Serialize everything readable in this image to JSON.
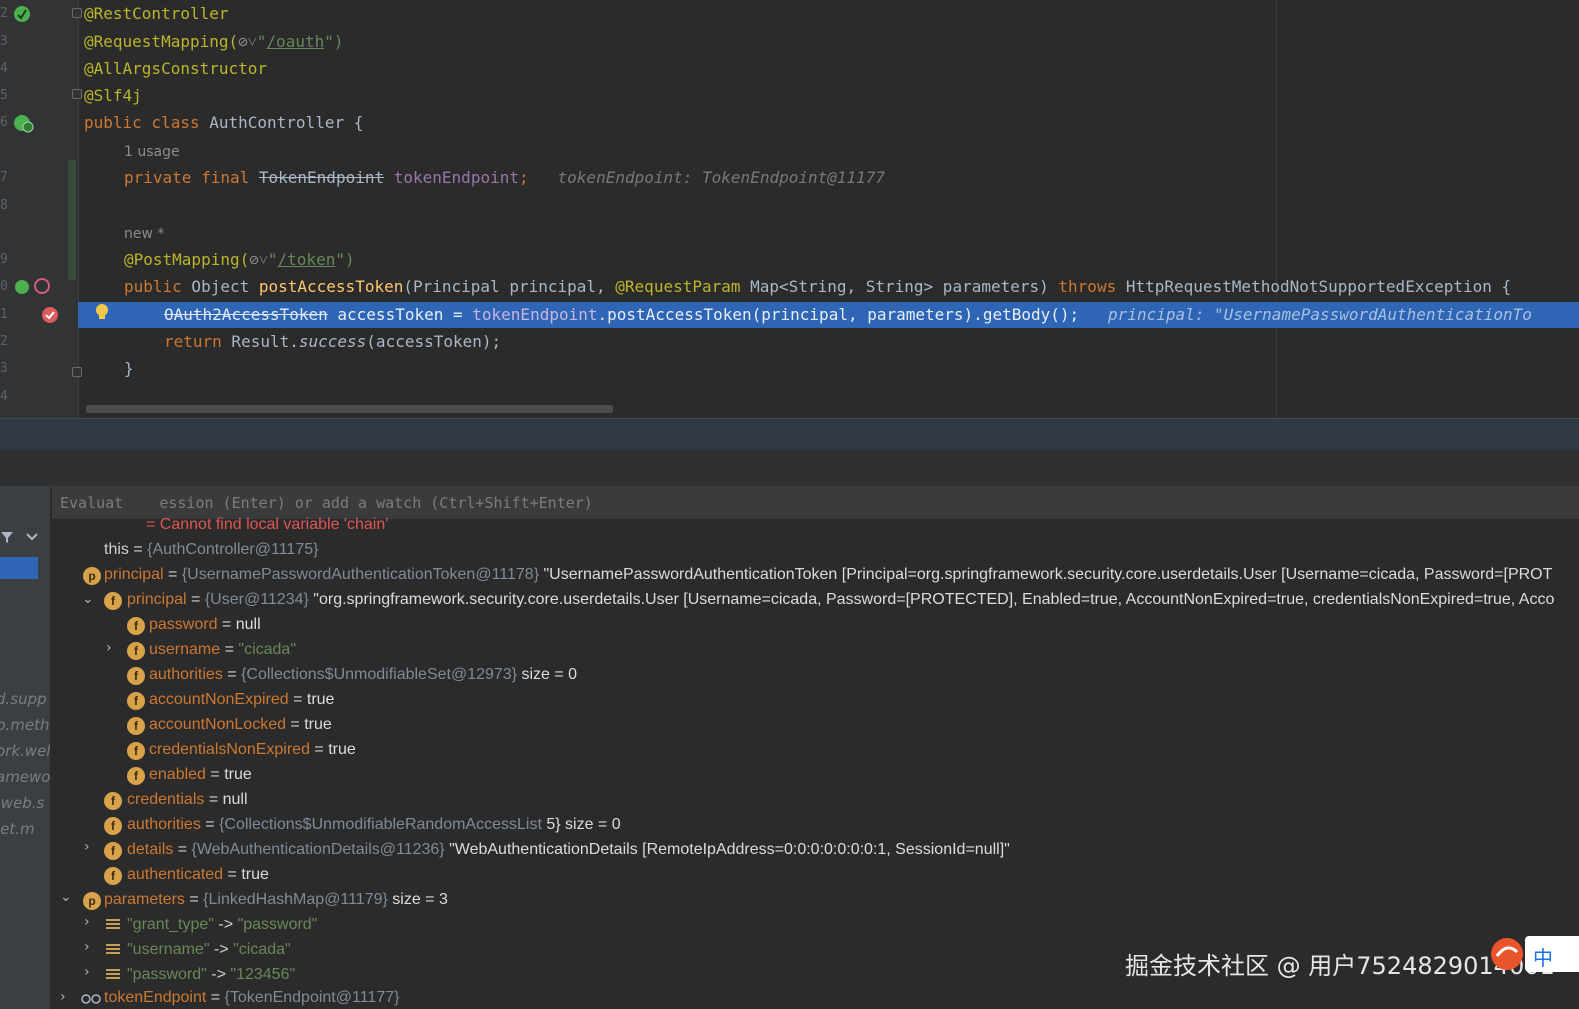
{
  "editor": {
    "line_numbers": [
      "2",
      "3",
      "4",
      "5",
      "6",
      "7",
      "8",
      "9",
      "0",
      "1",
      "2",
      "3",
      "4"
    ],
    "lines": {
      "l1": "@RestController",
      "l2_prefix": "@RequestMapping(",
      "l2_mid": "\"",
      "l2_path": "/oauth",
      "l2_suffix": "\")",
      "l3": "@AllArgsConstructor",
      "l4": "@Slf4j",
      "l5_kw": "public class",
      "l5_name": " AuthController {",
      "usage": "1 usage",
      "l6_kw": "private final",
      "l6_type": "TokenEndpoint",
      "l6_field": "tokenEndpoint",
      "l6_semi": ";",
      "l6_hint": "tokenEndpoint: TokenEndpoint@11177",
      "new_marker": "new *",
      "l7_ann": "@PostMapping(",
      "l7_quote": "\"",
      "l7_path": "/token",
      "l7_end": "\")",
      "l8_kw": "public",
      "l8_type": " Object ",
      "l8_fn": "postAccessToken",
      "l8_params1": "(Principal principal, ",
      "l8_ann": "@RequestParam",
      "l8_params2": " Map<String, String> parameters) ",
      "l8_throws": "throws",
      "l8_exc": " HttpRequestMethodNotSupportedException {",
      "l9_type": "OAuth2AccessToken",
      "l9_rest1": " accessToken = ",
      "l9_field": "tokenEndpoint",
      "l9_rest2": ".postAccessToken(principal, parameters).getBody();",
      "l9_hint": "principal: \"UsernamePasswordAuthenticationTo",
      "l10_kw": "return",
      "l10_mid": " Result.",
      "l10_fn": "success",
      "l10_end": "(accessToken);",
      "l11": "}"
    }
  },
  "debugger": {
    "eval_placeholder": "Evaluat    ession (Enter) or add a watch (Ctrl+Shift+Enter)",
    "left_panel_text": [
      "d.supp",
      "b.meth",
      "ork.wel",
      "amewo",
      ".web.s",
      "let.m"
    ],
    "vars": [
      {
        "name": "",
        "eq": " = ",
        "type": "",
        "value": "Cannot find local variable 'chain'",
        "err": true
      },
      {
        "name": "this",
        "eq": " = ",
        "type": "{AuthController@11175}",
        "value": ""
      },
      {
        "name": "principal",
        "eq": " = ",
        "type": "{UsernamePasswordAuthenticationToken@11178}",
        "value": " \"UsernamePasswordAuthenticationToken [Principal=org.springframework.security.core.userdetails.User [Username=cicada, Password=[PROT"
      },
      {
        "name": "principal",
        "eq": " = ",
        "type": "{User@11234}",
        "value": " \"org.springframework.security.core.userdetails.User [Username=cicada, Password=[PROTECTED], Enabled=true, AccountNonExpired=true, credentialsNonExpired=true, Acco"
      },
      {
        "name": "password",
        "eq": " = ",
        "type": "",
        "value": "null"
      },
      {
        "name": "username",
        "eq": " = ",
        "type": "",
        "value": "\"cicada\"",
        "str": true
      },
      {
        "name": "authorities",
        "eq": " = ",
        "type": "{Collections$UnmodifiableSet@12973}",
        "value": "  size = 0"
      },
      {
        "name": "accountNonExpired",
        "eq": " = ",
        "type": "",
        "value": "true"
      },
      {
        "name": "accountNonLocked",
        "eq": " = ",
        "type": "",
        "value": "true"
      },
      {
        "name": "credentialsNonExpired",
        "eq": " = ",
        "type": "",
        "value": "true"
      },
      {
        "name": "enabled",
        "eq": " = ",
        "type": "",
        "value": "true"
      },
      {
        "name": "credentials",
        "eq": " = ",
        "type": "",
        "value": "null"
      },
      {
        "name": "authorities",
        "eq": " = ",
        "type": "{Collections$UnmodifiableRandomAccessList",
        "value": "            5}  size = 0"
      },
      {
        "name": "details",
        "eq": " = ",
        "type": "{WebAuthenticationDetails@11236}",
        "value": " \"WebAuthenticationDetails [RemoteIpAddress=0:0:0:0:0:0:0:1, SessionId=null]\""
      },
      {
        "name": "authenticated",
        "eq": " = ",
        "type": "",
        "value": "true"
      },
      {
        "name": "parameters",
        "eq": " = ",
        "type": "{LinkedHashMap@11179}",
        "value": "  size = 3"
      },
      {
        "name": "\"grant_type\"",
        "eq": " -> ",
        "type": "",
        "value": "\"password\"",
        "str": true,
        "map": true
      },
      {
        "name": "\"username\"",
        "eq": " -> ",
        "type": "",
        "value": "\"cicada\"",
        "str": true,
        "map": true
      },
      {
        "name": "\"password\"",
        "eq": " -> ",
        "type": "",
        "value": "\"123456\"",
        "str": true,
        "map": true
      },
      {
        "name": "tokenEndpoint",
        "eq": " = ",
        "type": "{TokenEndpoint@11177}",
        "value": ""
      }
    ],
    "badges": {
      "field": "f",
      "param": "p"
    }
  },
  "watermark": "掘金技术社区 @ 用户7524829014001",
  "ime": "中"
}
